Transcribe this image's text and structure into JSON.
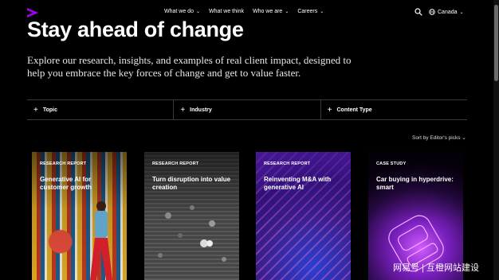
{
  "nav": {
    "items": [
      {
        "label": "What we do"
      },
      {
        "label": "What we think"
      },
      {
        "label": "Who we are"
      },
      {
        "label": "Careers"
      }
    ],
    "locale": "Canada",
    "icons": {
      "logo": "accenture-chevron-logo",
      "search": "search-icon",
      "globe": "globe-icon"
    }
  },
  "hero": {
    "title": "Stay ahead of change",
    "subtitle": "Explore our research, insights, and examples of real client impact, designed to help you embrace the key forces of change and get to value faster."
  },
  "filters": [
    {
      "label": "Topic"
    },
    {
      "label": "Industry"
    },
    {
      "label": "Content Type"
    }
  ],
  "sort_label": "Sort by Editor's picks",
  "cards": [
    {
      "eyebrow": "RESEARCH REPORT",
      "title": "Generative AI for customer growth"
    },
    {
      "eyebrow": "RESEARCH REPORT",
      "title": "Turn disruption into value creation"
    },
    {
      "eyebrow": "RESEARCH REPORT",
      "title": "Reinventing M&A with generative AI"
    },
    {
      "eyebrow": "CASE STUDY",
      "title": "Car buying in hyperdrive: smart"
    }
  ],
  "watermark": "网易号 | 互橙网站建设",
  "colors": {
    "background": "#000000",
    "accent": "#a100ff"
  }
}
